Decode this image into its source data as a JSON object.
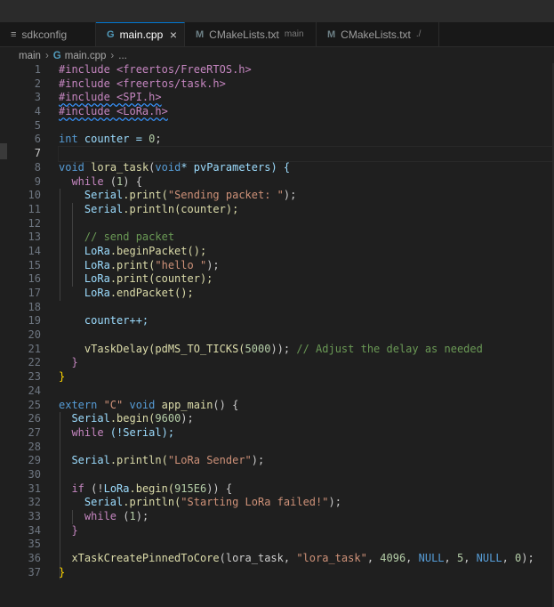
{
  "tabs": [
    {
      "icon": "≡",
      "label": "sdkconfig",
      "sub": "",
      "active": false
    },
    {
      "icon": "G",
      "label": "main.cpp",
      "sub": "",
      "active": true
    },
    {
      "icon": "M",
      "label": "CMakeLists.txt",
      "sub": "main",
      "active": false
    },
    {
      "icon": "M",
      "label": "CMakeLists.txt",
      "sub": "./",
      "active": false
    }
  ],
  "breadcrumb": {
    "folder": "main",
    "file": "main.cpp",
    "more": "..."
  },
  "line_numbers": [
    "1",
    "2",
    "3",
    "4",
    "5",
    "6",
    "7",
    "8",
    "9",
    "10",
    "11",
    "12",
    "13",
    "14",
    "15",
    "16",
    "17",
    "18",
    "19",
    "20",
    "21",
    "22",
    "23",
    "24",
    "25",
    "26",
    "27",
    "28",
    "29",
    "30",
    "31",
    "32",
    "33",
    "34",
    "35",
    "36",
    "37"
  ],
  "code": {
    "l1": "#include <freertos/FreeRTOS.h>",
    "l2": "#include <freertos/task.h>",
    "l3": "#include <SPI.h>",
    "l4": "#include <LoRa.h>",
    "l6a": "int",
    "l6b": " counter = ",
    "l6c": "0",
    "l6d": ";",
    "l8a": "void",
    "l8b": "lora_task",
    "l8c": "(",
    "l8d": "void",
    "l8e": "* pvParameters) {",
    "l9a": "while",
    "l9b": " (",
    "l9c": "1",
    "l9d": ") {",
    "l10a": "Serial",
    "l10b": ".print(",
    "l10c": "\"Sending packet: \"",
    "l10d": ");",
    "l11a": "Serial",
    "l11b": ".println(counter);",
    "l13": "// send packet",
    "l14a": "LoRa",
    "l14b": ".beginPacket();",
    "l15a": "LoRa",
    "l15b": ".print(",
    "l15c": "\"hello \"",
    "l15d": ");",
    "l16a": "LoRa",
    "l16b": ".print(counter);",
    "l17a": "LoRa",
    "l17b": ".endPacket();",
    "l19": "counter++;",
    "l21a": "vTaskDelay",
    "l21b": "(pdMS_TO_TICKS(",
    "l21c": "5000",
    "l21d": ")); ",
    "l21e": "// Adjust the delay as needed",
    "l22": "}",
    "l23": "}",
    "l25a": "extern",
    "l25b": " \"C\" ",
    "l25c": "void",
    "l25d": " app_main",
    "l25e": "() {",
    "l26a": "Serial",
    "l26b": ".begin(",
    "l26c": "9600",
    "l26d": ");",
    "l27a": "while",
    "l27b": " (!Serial);",
    "l29a": "Serial",
    "l29b": ".println(",
    "l29c": "\"LoRa Sender\"",
    "l29d": ");",
    "l31a": "if",
    "l31b": " (!",
    "l31c": "LoRa",
    "l31d": ".begin(",
    "l31e": "915E6",
    "l31f": ")) {",
    "l32a": "Serial",
    "l32b": ".println(",
    "l32c": "\"Starting LoRa failed!\"",
    "l32d": ");",
    "l33a": "while",
    "l33b": " (",
    "l33c": "1",
    "l33d": ");",
    "l34": "}",
    "l36a": "xTaskCreatePinnedToCore",
    "l36b": "(lora_task, ",
    "l36c": "\"lora_task\"",
    "l36d": ", ",
    "l36e": "4096",
    "l36f": ", ",
    "l36g": "NULL",
    "l36h": ", ",
    "l36i": "5",
    "l36j": ", ",
    "l36k": "NULL",
    "l36l": ", ",
    "l36m": "0",
    "l36n": ");",
    "l37": "}"
  },
  "colors": {
    "editor_bg": "#1f1f1f",
    "keyword": "#569cd6",
    "control": "#c586c0",
    "string": "#ce9178",
    "number": "#b5cea8",
    "comment": "#6a9955",
    "function": "#dcdcaa",
    "variable": "#9cdcfe",
    "class": "#4ec9b0"
  }
}
